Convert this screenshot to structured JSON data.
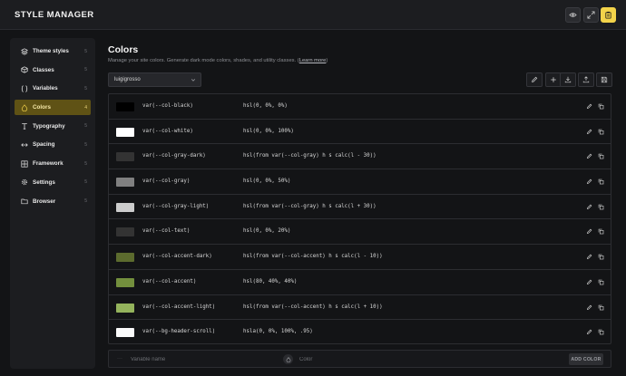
{
  "app": {
    "title": "STYLE MANAGER"
  },
  "header": {
    "buttons": [
      {
        "icon": "eye-icon"
      },
      {
        "icon": "expand-icon"
      },
      {
        "icon": "clipboard-icon"
      }
    ]
  },
  "sidebar": {
    "items": [
      {
        "label": "Theme styles",
        "count": "5",
        "icon": "layers-icon",
        "active": false
      },
      {
        "label": "Classes",
        "count": "5",
        "icon": "box-icon",
        "active": false
      },
      {
        "label": "Variables",
        "count": "5",
        "icon": "braces-icon",
        "active": false
      },
      {
        "label": "Colors",
        "count": "4",
        "icon": "droplet-icon",
        "active": true
      },
      {
        "label": "Typography",
        "count": "5",
        "icon": "type-icon",
        "active": false
      },
      {
        "label": "Spacing",
        "count": "5",
        "icon": "arrows-h-icon",
        "active": false
      },
      {
        "label": "Framework",
        "count": "5",
        "icon": "grid-icon",
        "active": false
      },
      {
        "label": "Settings",
        "count": "5",
        "icon": "gear-icon",
        "active": false
      },
      {
        "label": "Browser",
        "count": "5",
        "icon": "folder-icon",
        "active": false
      }
    ]
  },
  "main": {
    "title": "Colors",
    "subtitle": "Manage your site colors. Generate dark mode colors, shades, and utility classes.",
    "learn_more": "Learn more",
    "palette_select": "luigigrosso",
    "toolbar": [
      {
        "icon": "pencil-icon"
      },
      {
        "icon": "plus-icon"
      },
      {
        "icon": "download-icon"
      },
      {
        "icon": "upload-icon"
      },
      {
        "icon": "save-icon"
      }
    ]
  },
  "colors": [
    {
      "name": "var(--col-black)",
      "value": "hsl(0, 0%, 0%)",
      "swatch": "#000000"
    },
    {
      "name": "var(--col-white)",
      "value": "hsl(0, 0%, 100%)",
      "swatch": "#ffffff"
    },
    {
      "name": "var(--col-gray-dark)",
      "value": "hsl(from var(--col-gray) h s calc(l - 30))",
      "swatch": "#333333"
    },
    {
      "name": "var(--col-gray)",
      "value": "hsl(0, 0%, 50%)",
      "swatch": "#808080"
    },
    {
      "name": "var(--col-gray-light)",
      "value": "hsl(from var(--col-gray) h s calc(l + 30))",
      "swatch": "#cccccc"
    },
    {
      "name": "var(--col-text)",
      "value": "hsl(0, 0%, 20%)",
      "swatch": "#333333"
    },
    {
      "name": "var(--col-accent-dark)",
      "value": "hsl(from var(--col-accent) h s calc(l - 10))",
      "swatch": "#5c6b2e"
    },
    {
      "name": "var(--col-accent)",
      "value": "hsl(80, 40%, 40%)",
      "swatch": "#738f3d"
    },
    {
      "name": "var(--col-accent-light)",
      "value": "hsl(from var(--col-accent) h s calc(l + 10))",
      "swatch": "#94b35c"
    },
    {
      "name": "var(--bg-header-scroll)",
      "value": "hsla(0, 0%, 100%, .95)",
      "swatch": "#fafafa"
    }
  ],
  "add_bar": {
    "name_placeholder": "Variable name",
    "color_placeholder": "Color",
    "add_label": "ADD COLOR"
  },
  "theme": {
    "accent": "#f3d34a",
    "active_nav_bg": "#5f5215",
    "background": "#131416",
    "panel": "#1c1d20"
  }
}
